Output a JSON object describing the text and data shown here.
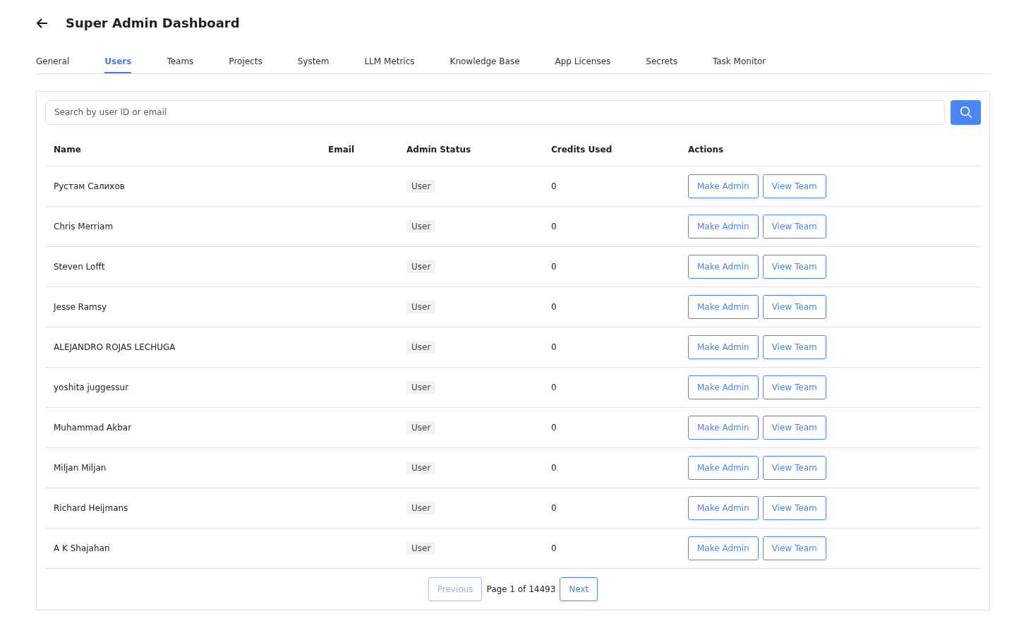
{
  "header": {
    "title": "Super Admin Dashboard"
  },
  "tabs": [
    {
      "label": "General",
      "selected": false
    },
    {
      "label": "Users",
      "selected": true
    },
    {
      "label": "Teams",
      "selected": false
    },
    {
      "label": "Projects",
      "selected": false
    },
    {
      "label": "System",
      "selected": false
    },
    {
      "label": "LLM Metrics",
      "selected": false
    },
    {
      "label": "Knowledge Base",
      "selected": false
    },
    {
      "label": "App Licenses",
      "selected": false
    },
    {
      "label": "Secrets",
      "selected": false
    },
    {
      "label": "Task Monitor",
      "selected": false
    }
  ],
  "search": {
    "placeholder": "Search by user ID or email"
  },
  "table": {
    "columns": [
      "Name",
      "Email",
      "Admin Status",
      "Credits Used",
      "Actions"
    ],
    "rows": [
      {
        "name": "Рустам Салихов",
        "status": "User",
        "credits": "0",
        "actions": [
          "Make Admin",
          "View Team"
        ]
      },
      {
        "name": "Chris Merriam",
        "status": "User",
        "credits": "0",
        "actions": [
          "Make Admin",
          "View Team"
        ]
      },
      {
        "name": "Steven Lofft",
        "status": "User",
        "credits": "0",
        "actions": [
          "Make Admin",
          "View Team"
        ]
      },
      {
        "name": "Jesse Ramsy",
        "status": "User",
        "credits": "0",
        "actions": [
          "Make Admin",
          "View Team"
        ]
      },
      {
        "name": "ALEJANDRO ROJAS LECHUGA",
        "status": "User",
        "credits": "0",
        "actions": [
          "Make Admin",
          "View Team"
        ]
      },
      {
        "name": "yoshita juggessur",
        "status": "User",
        "credits": "0",
        "actions": [
          "Make Admin",
          "View Team"
        ]
      },
      {
        "name": "Muhammad Akbar",
        "status": "User",
        "credits": "0",
        "actions": [
          "Make Admin",
          "View Team"
        ]
      },
      {
        "name": "Miljan Miljan",
        "status": "User",
        "credits": "0",
        "actions": [
          "Make Admin",
          "View Team"
        ]
      },
      {
        "name": "Richard Heijmans",
        "status": "User",
        "credits": "0",
        "actions": [
          "Make Admin",
          "View Team"
        ]
      },
      {
        "name": "A K Shajahan",
        "status": "User",
        "credits": "0",
        "actions": [
          "Make Admin",
          "View Team"
        ]
      }
    ]
  },
  "pagination": {
    "previous": {
      "label": "Previous",
      "disabled": true
    },
    "info": "Page 1 of 14493",
    "next": {
      "label": "Next",
      "disabled": false
    }
  }
}
